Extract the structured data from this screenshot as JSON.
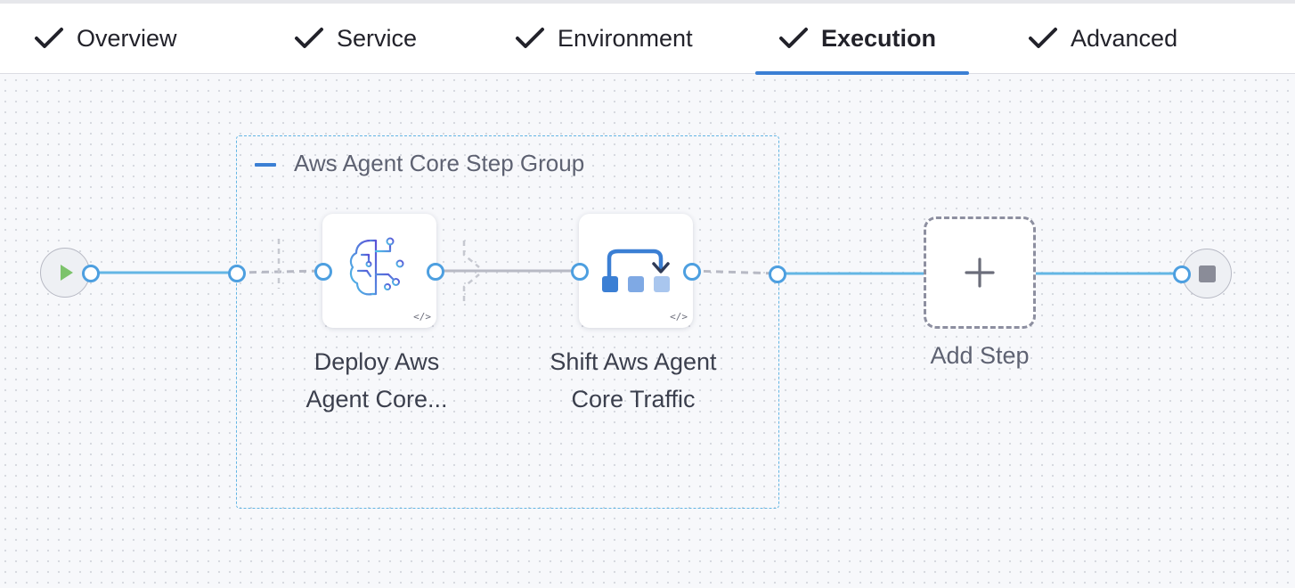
{
  "tabs": [
    {
      "label": "Overview",
      "completed": true,
      "active": false
    },
    {
      "label": "Service",
      "completed": true,
      "active": false
    },
    {
      "label": "Environment",
      "completed": true,
      "active": false
    },
    {
      "label": "Execution",
      "completed": true,
      "active": true
    },
    {
      "label": "Advanced",
      "completed": true,
      "active": false
    }
  ],
  "pipeline": {
    "step_group": {
      "title": "Aws Agent Core Step Group",
      "steps": [
        {
          "label_line1": "Deploy Aws",
          "label_line2": "Agent Core...",
          "icon": "ai-brain-circuit-icon"
        },
        {
          "label_line1": "Shift Aws Agent",
          "label_line2": "Core Traffic",
          "icon": "traffic-shift-icon"
        }
      ]
    },
    "add_step": {
      "label": "Add Step",
      "icon": "plus-icon"
    },
    "start_icon": "play-icon",
    "end_icon": "stop-icon",
    "code_icon_glyph": "</>"
  },
  "colors": {
    "accent": "#3b7fd4",
    "wire": "#64b6e4",
    "dashed_wire": "#b7b9c4",
    "play": "#7cc36b",
    "stop": "#8a8c98"
  }
}
